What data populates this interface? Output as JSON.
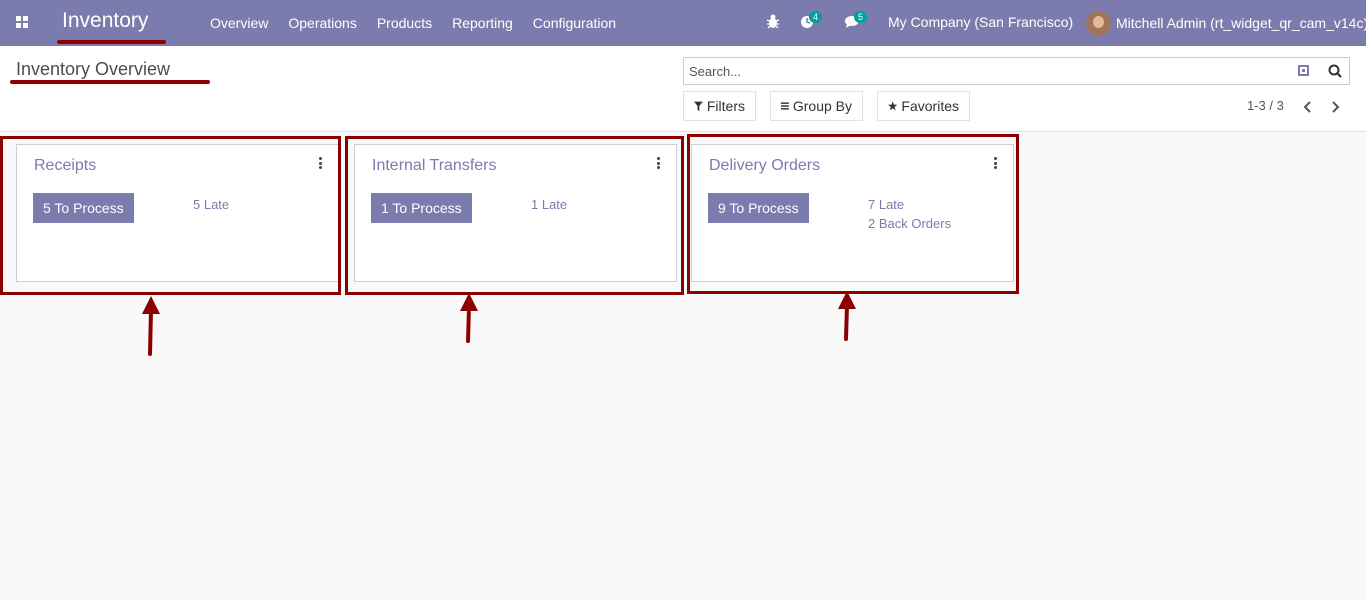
{
  "navbar": {
    "app_name": "Inventory",
    "menu": [
      "Overview",
      "Operations",
      "Products",
      "Reporting",
      "Configuration"
    ],
    "activity_count": "4",
    "messages_count": "5",
    "company": "My Company (San Francisco)",
    "user": "Mitchell Admin (rt_widget_qr_cam_v14c)",
    "color": "#7c7bad"
  },
  "control_panel": {
    "title": "Inventory Overview",
    "search_placeholder": "Search...",
    "filters_label": "Filters",
    "group_by_label": "Group By",
    "favorites_label": "Favorites",
    "pager": "1-3 / 3"
  },
  "cards": [
    {
      "title": "Receipts",
      "process_label": "5 To Process",
      "links": [
        "5 Late"
      ]
    },
    {
      "title": "Internal Transfers",
      "process_label": "1 To Process",
      "links": [
        "1 Late"
      ]
    },
    {
      "title": "Delivery Orders",
      "process_label": "9 To Process",
      "links": [
        "7 Late",
        "2 Back Orders"
      ]
    }
  ],
  "annotation_color": "#8b0000"
}
